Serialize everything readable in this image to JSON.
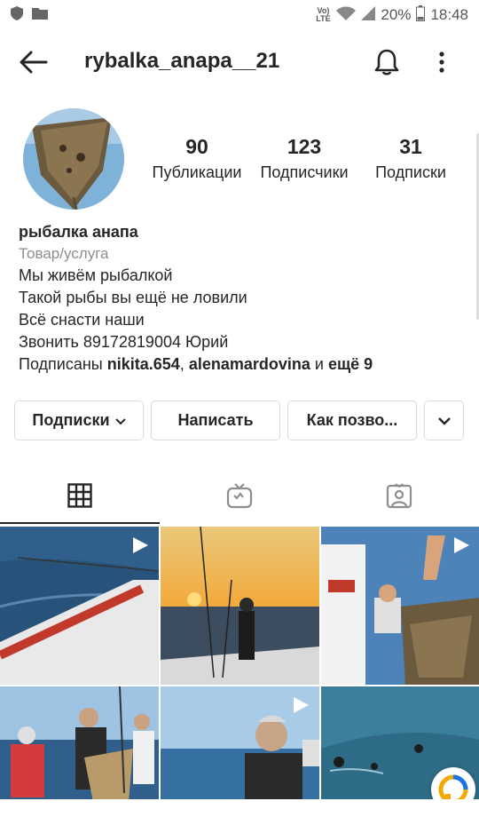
{
  "status_bar": {
    "network": "Vo) LTE",
    "battery": "20%",
    "time": "18:48"
  },
  "header": {
    "username": "rybalka_anapa__21",
    "icons": [
      "back-arrow-icon",
      "bell-icon",
      "more-vertical-icon"
    ]
  },
  "stats": [
    {
      "count": "90",
      "label": "Публикации"
    },
    {
      "count": "123",
      "label": "Подписчики"
    },
    {
      "count": "31",
      "label": "Подписки"
    }
  ],
  "bio": {
    "name": "рыбалка анапа",
    "category": "Товар/услуга",
    "lines": [
      "Мы живём рыбалкой",
      "Такой рыбы вы ещё не ловили",
      "Всё снасти наши",
      "Звонить 89172819004 Юрий"
    ],
    "followed_prefix": "Подписаны ",
    "followed_user1": "nikita.654",
    "followed_sep": ", ",
    "followed_user2": "alenamardovina",
    "followed_and": " и ",
    "followed_more": "ещё 9"
  },
  "buttons": {
    "following": "Подписки",
    "message": "Написать",
    "contact": "Как позво...",
    "suggested_icon": "chevron-down-icon"
  },
  "tabs": [
    "grid-icon",
    "igtv-icon",
    "tagged-icon"
  ],
  "colors": {
    "text": "#262626",
    "secondary": "#8e8e8e",
    "border": "#dbdbdb"
  }
}
